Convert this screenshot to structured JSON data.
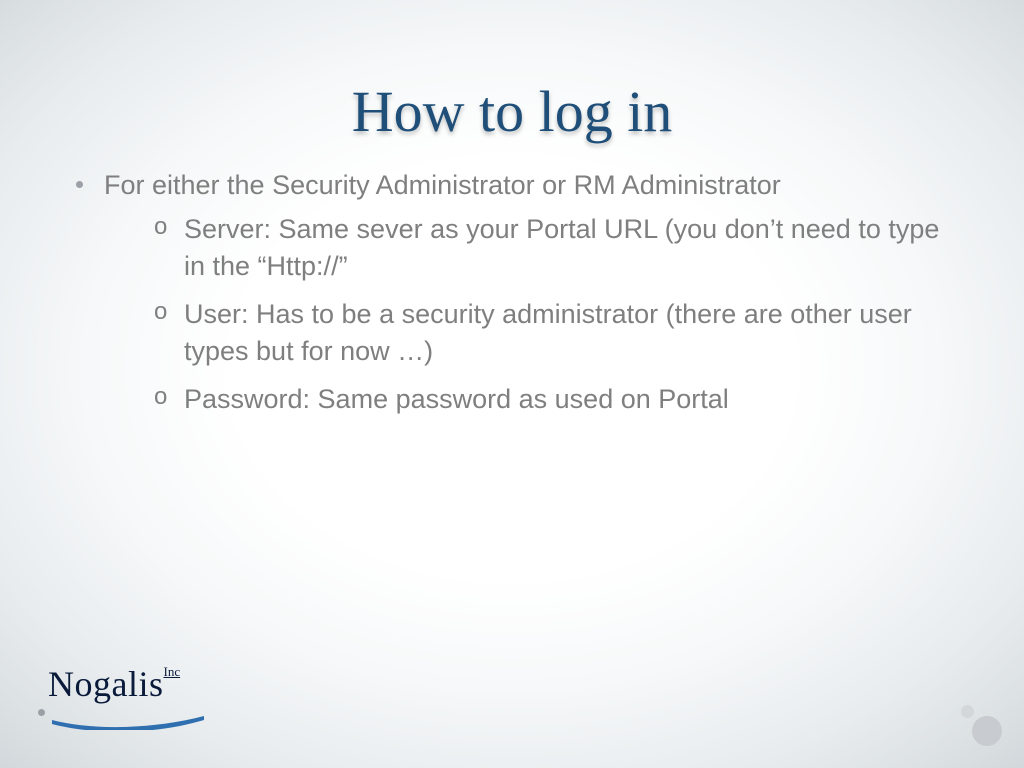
{
  "title": "How to log in",
  "bullets": {
    "item0": {
      "text": "For either the Security Administrator or RM Administrator",
      "sub": {
        "s0": "Server: Same sever as your Portal URL (you don’t need to type in the “Http://”",
        "s1": "User: Has to be a security administrator (there are other user types but for now …)",
        "s2": "Password: Same password as used on Portal"
      }
    }
  },
  "logo": {
    "company": "Nogalis",
    "suffix": "Inc"
  }
}
